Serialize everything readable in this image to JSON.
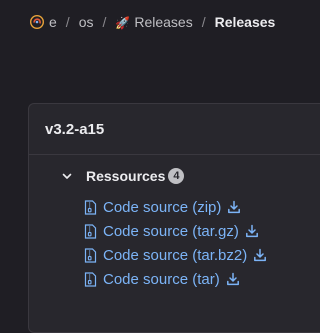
{
  "breadcrumb": {
    "project": "e",
    "group": "os",
    "releases_emoji": "🚀",
    "releases_link": "Releases",
    "current": "Releases",
    "separator": "/"
  },
  "release": {
    "tag": "v3.2-a15",
    "assets_title": "Ressources",
    "assets_count": "4",
    "assets": [
      {
        "label": "Code source (zip)"
      },
      {
        "label": "Code source (tar.gz)"
      },
      {
        "label": "Code source (tar.bz2)"
      },
      {
        "label": "Code source (tar)"
      }
    ]
  },
  "colors": {
    "background": "#1f1e24",
    "card": "#28272d",
    "link": "#7cb4f7",
    "text": "#ececef"
  },
  "icons": {
    "project_avatar": "project-avatar-icon",
    "chevron": "chevron-down-icon",
    "file": "file-zip-icon",
    "download": "download-icon"
  }
}
